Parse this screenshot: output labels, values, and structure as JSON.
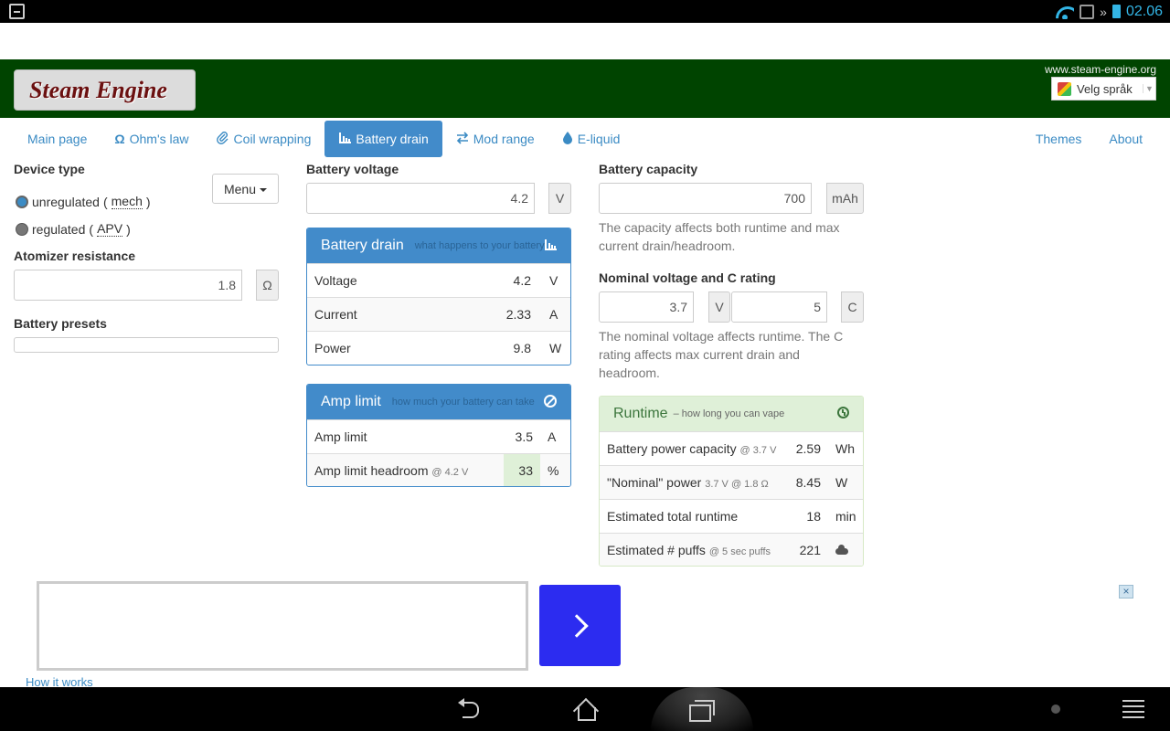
{
  "status_bar": {
    "time": "02.06"
  },
  "header": {
    "logo": "Steam Engine",
    "site_url": "www.steam-engine.org",
    "language_label": "Velg språk"
  },
  "nav": {
    "items": [
      {
        "label": "Main page",
        "icon": ""
      },
      {
        "label": "Ohm's law",
        "icon": "Ω"
      },
      {
        "label": "Coil wrapping",
        "icon": "paperclip-icon"
      },
      {
        "label": "Battery drain",
        "icon": "bar-chart-icon",
        "active": true
      },
      {
        "label": "Mod range",
        "icon": "transfer-icon"
      },
      {
        "label": "E-liquid",
        "icon": "drop-icon"
      }
    ],
    "right": [
      "Themes",
      "About"
    ]
  },
  "device": {
    "title": "Device type",
    "menu_label": "Menu",
    "options": [
      {
        "label": "unregulated",
        "abbr": "mech",
        "checked": true
      },
      {
        "label": "regulated",
        "abbr": "APV",
        "checked": false
      }
    ]
  },
  "atomizer": {
    "title": "Atomizer resistance",
    "value": "1.8",
    "unit": "Ω"
  },
  "presets": {
    "title": "Battery presets"
  },
  "battery_voltage": {
    "title": "Battery voltage",
    "value": "4.2",
    "unit": "V"
  },
  "battery_drain": {
    "title": "Battery drain",
    "subtitle": "what happens to your battery",
    "rows": [
      {
        "label": "Voltage",
        "value": "4.2",
        "unit": "V"
      },
      {
        "label": "Current",
        "value": "2.33",
        "unit": "A"
      },
      {
        "label": "Power",
        "value": "9.8",
        "unit": "W"
      }
    ]
  },
  "amp_limit": {
    "title": "Amp limit",
    "subtitle": "how much your battery can take",
    "rows": [
      {
        "label": "Amp limit",
        "note": "",
        "value": "3.5",
        "unit": "A"
      },
      {
        "label": "Amp limit headroom",
        "note": "@ 4.2 V",
        "value": "33",
        "unit": "%"
      }
    ]
  },
  "capacity": {
    "title": "Battery capacity",
    "value": "700",
    "unit": "mAh",
    "help": "The capacity affects both runtime and max current drain/headroom."
  },
  "nominal": {
    "title": "Nominal voltage and C rating",
    "voltage": "3.7",
    "voltage_unit": "V",
    "c_rating": "5",
    "c_unit": "C",
    "help": "The nominal voltage affects runtime. The C rating affects max current drain and headroom."
  },
  "runtime": {
    "title": "Runtime",
    "subtitle": "– how long you can vape",
    "rows": [
      {
        "label": "Battery power capacity",
        "note": "@ 3.7 V",
        "value": "2.59",
        "unit": "Wh"
      },
      {
        "label": "\"Nominal\" power",
        "note": "3.7 V @ 1.8 Ω",
        "value": "8.45",
        "unit": "W"
      },
      {
        "label": "Estimated total runtime",
        "note": "",
        "value": "18",
        "unit": "min"
      },
      {
        "label": "Estimated # puffs",
        "note": "@ 5 sec puffs",
        "value": "221",
        "unit": ""
      }
    ]
  },
  "ad": {
    "close": "×",
    "link": "How it works"
  }
}
